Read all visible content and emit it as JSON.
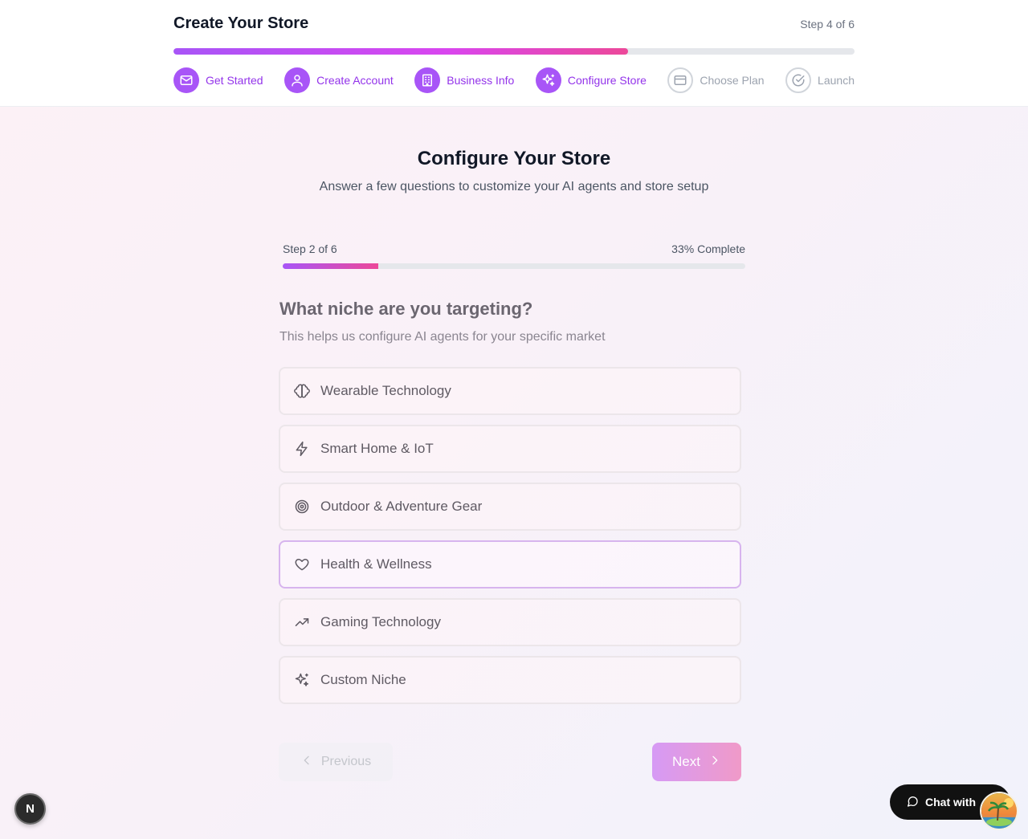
{
  "header": {
    "title": "Create Your Store",
    "step_indicator": "Step 4 of 6",
    "progress_percent": 66.7,
    "steps": [
      {
        "label": "Get Started",
        "icon": "mail-icon",
        "state": "done"
      },
      {
        "label": "Create Account",
        "icon": "user-icon",
        "state": "done"
      },
      {
        "label": "Business Info",
        "icon": "building-icon",
        "state": "done"
      },
      {
        "label": "Configure Store",
        "icon": "sparkles-icon",
        "state": "current"
      },
      {
        "label": "Choose Plan",
        "icon": "credit-card-icon",
        "state": "pending"
      },
      {
        "label": "Launch",
        "icon": "check-circle-icon",
        "state": "pending"
      }
    ]
  },
  "main": {
    "title": "Configure Your Store",
    "subtitle": "Answer a few questions to customize your AI agents and store setup",
    "sub_progress": {
      "step_text": "Step 2 of 6",
      "complete_text": "33% Complete",
      "percent": 20.7
    },
    "question": "What niche are you targeting?",
    "question_help": "This helps us configure AI agents for your specific market",
    "options": [
      {
        "label": "Wearable Technology",
        "icon": "brain-icon",
        "selected": false
      },
      {
        "label": "Smart Home & IoT",
        "icon": "lightning-icon",
        "selected": false
      },
      {
        "label": "Outdoor & Adventure Gear",
        "icon": "target-icon",
        "selected": false
      },
      {
        "label": "Health & Wellness",
        "icon": "heart-icon",
        "selected": true
      },
      {
        "label": "Gaming Technology",
        "icon": "trending-up-icon",
        "selected": false
      },
      {
        "label": "Custom Niche",
        "icon": "sparkles-icon",
        "selected": false
      }
    ],
    "prev_label": "Previous",
    "next_label": "Next"
  },
  "overlay": {
    "n_badge": "N",
    "chat_label": "Chat with"
  },
  "colors": {
    "accent": "#a855f7",
    "accent_pink": "#ec4899",
    "pending": "#9ca3af"
  }
}
